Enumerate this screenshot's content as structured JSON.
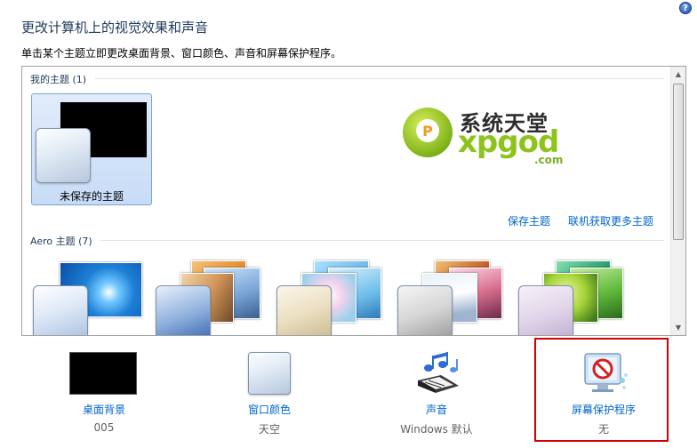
{
  "window": {
    "title": "更改计算机上的视觉效果和声音",
    "description": "单击某个主题立即更改桌面背景、窗口颜色、声音和屏幕保护程序。",
    "help_glyph": "?"
  },
  "my_themes": {
    "header": "我的主题 (1)",
    "items": [
      {
        "label": "未保存的主题",
        "selected": true
      }
    ]
  },
  "links": {
    "save_theme": "保存主题",
    "get_more": "联机获取更多主题"
  },
  "aero_themes": {
    "header": "Aero 主题 (7)"
  },
  "watermark": {
    "top_text": "系统天堂",
    "main_text": "xpgod",
    "suffix": ".com",
    "logo_letter": "P"
  },
  "bottom_bar": {
    "desktop_background": {
      "label": "桌面背景",
      "value": "005"
    },
    "window_color": {
      "label": "窗口颜色",
      "value": "天空"
    },
    "sound": {
      "label": "声音",
      "value": "Windows 默认"
    },
    "screen_saver": {
      "label": "屏幕保护程序",
      "value": "无"
    }
  },
  "colors": {
    "title": "#1e395b",
    "link": "#0066cc",
    "highlight": "#d40000",
    "selection": "#c7dcf7"
  }
}
